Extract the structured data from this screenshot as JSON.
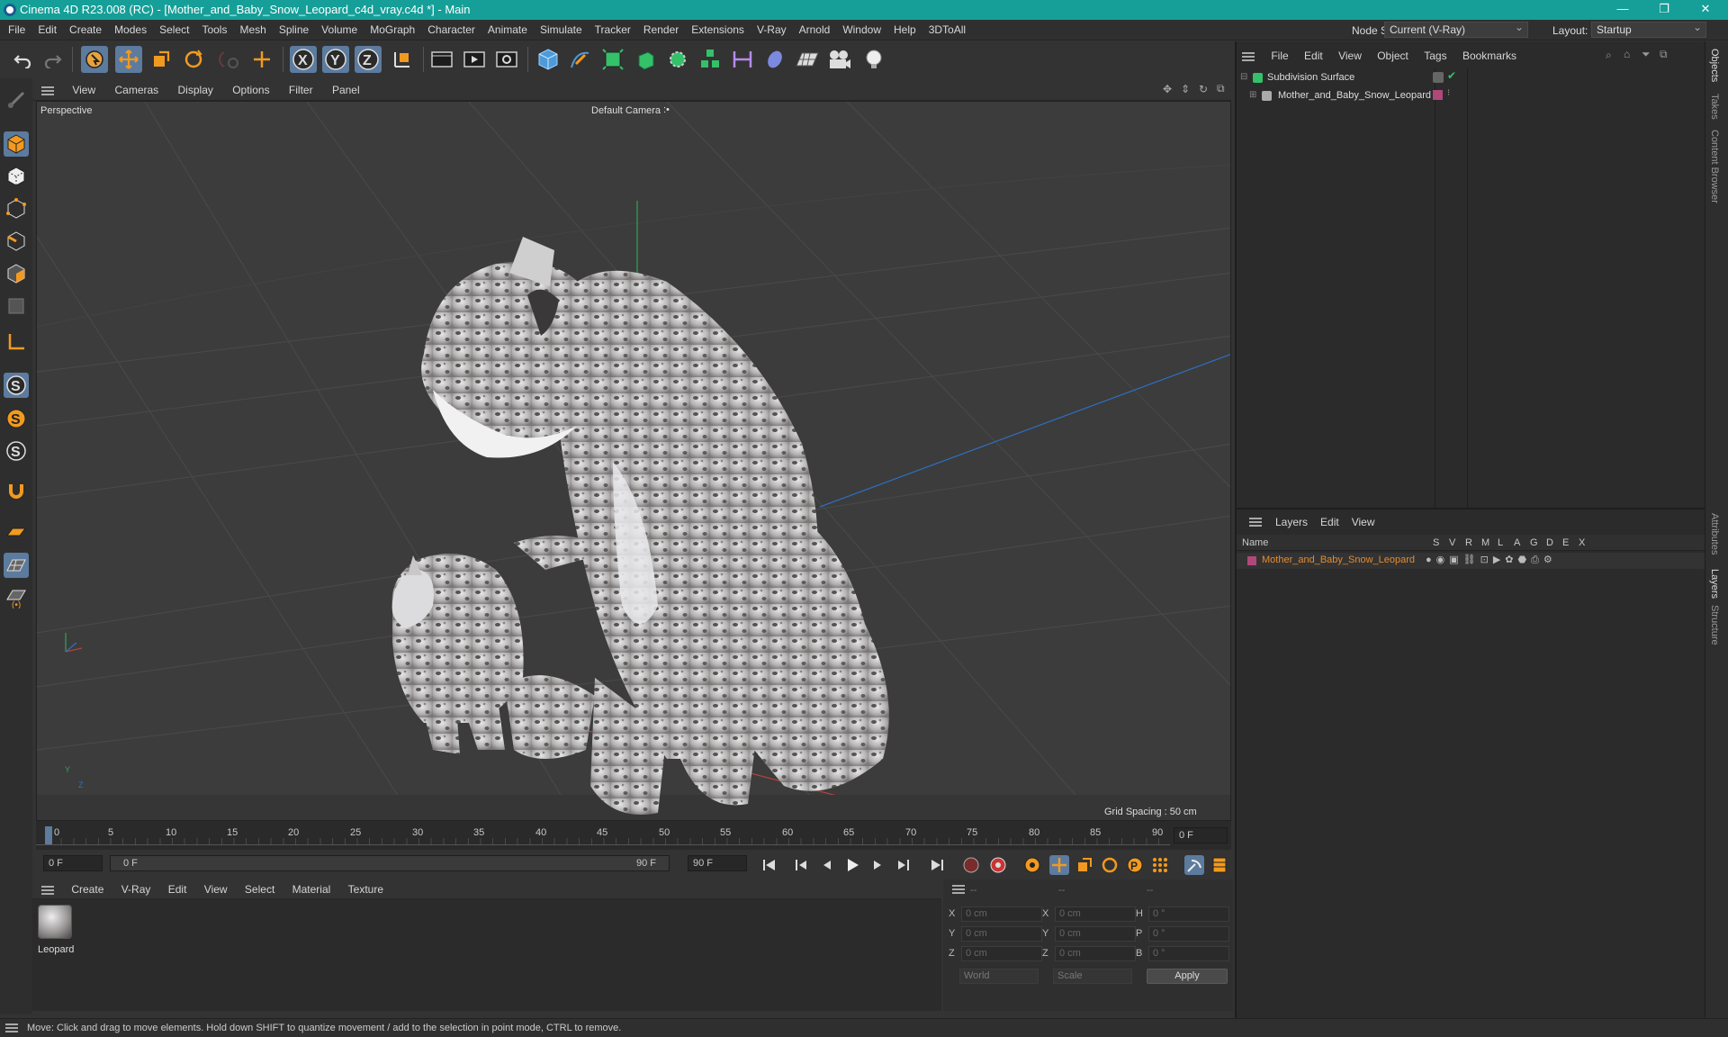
{
  "window": {
    "title": "Cinema 4D R23.008 (RC) - [Mother_and_Baby_Snow_Leopard_c4d_vray.c4d *] - Main"
  },
  "menu": [
    "File",
    "Edit",
    "Create",
    "Modes",
    "Select",
    "Tools",
    "Mesh",
    "Spline",
    "Volume",
    "MoGraph",
    "Character",
    "Animate",
    "Simulate",
    "Tracker",
    "Render",
    "Extensions",
    "V-Ray",
    "Arnold",
    "Window",
    "Help",
    "3DToAll"
  ],
  "node_space": {
    "label": "Node Space:",
    "value": "Current (V-Ray)"
  },
  "layout": {
    "label": "Layout:",
    "value": "Startup"
  },
  "viewport": {
    "menu": [
      "View",
      "Cameras",
      "Display",
      "Options",
      "Filter",
      "Panel"
    ],
    "name": "Perspective",
    "camera": "Default Camera",
    "camera_icon": ":•",
    "grid_spacing": "Grid Spacing : 50 cm",
    "axis_y": "Y",
    "axis_z": "Z"
  },
  "timeline": {
    "ticks": [
      "0",
      "5",
      "10",
      "15",
      "20",
      "25",
      "30",
      "35",
      "40",
      "45",
      "50",
      "55",
      "60",
      "65",
      "70",
      "75",
      "80",
      "85",
      "90"
    ],
    "current_frame": "0 F"
  },
  "transport": {
    "start": "0 F",
    "range_start": "0 F",
    "range_end": "90 F",
    "end": "90 F"
  },
  "materials": {
    "menu": [
      "Create",
      "V-Ray",
      "Edit",
      "View",
      "Select",
      "Material",
      "Texture"
    ],
    "items": [
      {
        "name": "Leopard"
      }
    ]
  },
  "coords": {
    "headers": [
      "--",
      "--",
      "--"
    ],
    "rows": [
      {
        "a": "X",
        "av": "0 cm",
        "b": "X",
        "bv": "0 cm",
        "c": "H",
        "cv": "0 °"
      },
      {
        "a": "Y",
        "av": "0 cm",
        "b": "Y",
        "bv": "0 cm",
        "c": "P",
        "cv": "0 °"
      },
      {
        "a": "Z",
        "av": "0 cm",
        "b": "Z",
        "bv": "0 cm",
        "c": "B",
        "cv": "0 °"
      }
    ],
    "world": "World",
    "scale": "Scale",
    "apply": "Apply"
  },
  "objects": {
    "menu": [
      "File",
      "Edit",
      "View",
      "Object",
      "Tags",
      "Bookmarks"
    ],
    "items": [
      {
        "name": "Subdivision Surface"
      },
      {
        "name": "Mother_and_Baby_Snow_Leopard"
      }
    ]
  },
  "layers": {
    "menu": [
      "Layers",
      "Edit",
      "View"
    ],
    "header_name": "Name",
    "cols": [
      "S",
      "V",
      "R",
      "M",
      "L",
      "A",
      "G",
      "D",
      "E",
      "X"
    ],
    "items": [
      {
        "name": "Mother_and_Baby_Snow_Leopard",
        "color": "#b0487a"
      }
    ]
  },
  "right_tabs": [
    "Objects",
    "Takes",
    "Content Browser",
    "Attributes",
    "Layers",
    "Structure"
  ],
  "status": "Move: Click and drag to move elements. Hold down SHIFT to quantize movement / add to the selection in point mode, CTRL to remove.",
  "colors": {
    "accent": "#159f98",
    "selection": "#5c7b9e",
    "layer_text": "#e58a2e"
  }
}
